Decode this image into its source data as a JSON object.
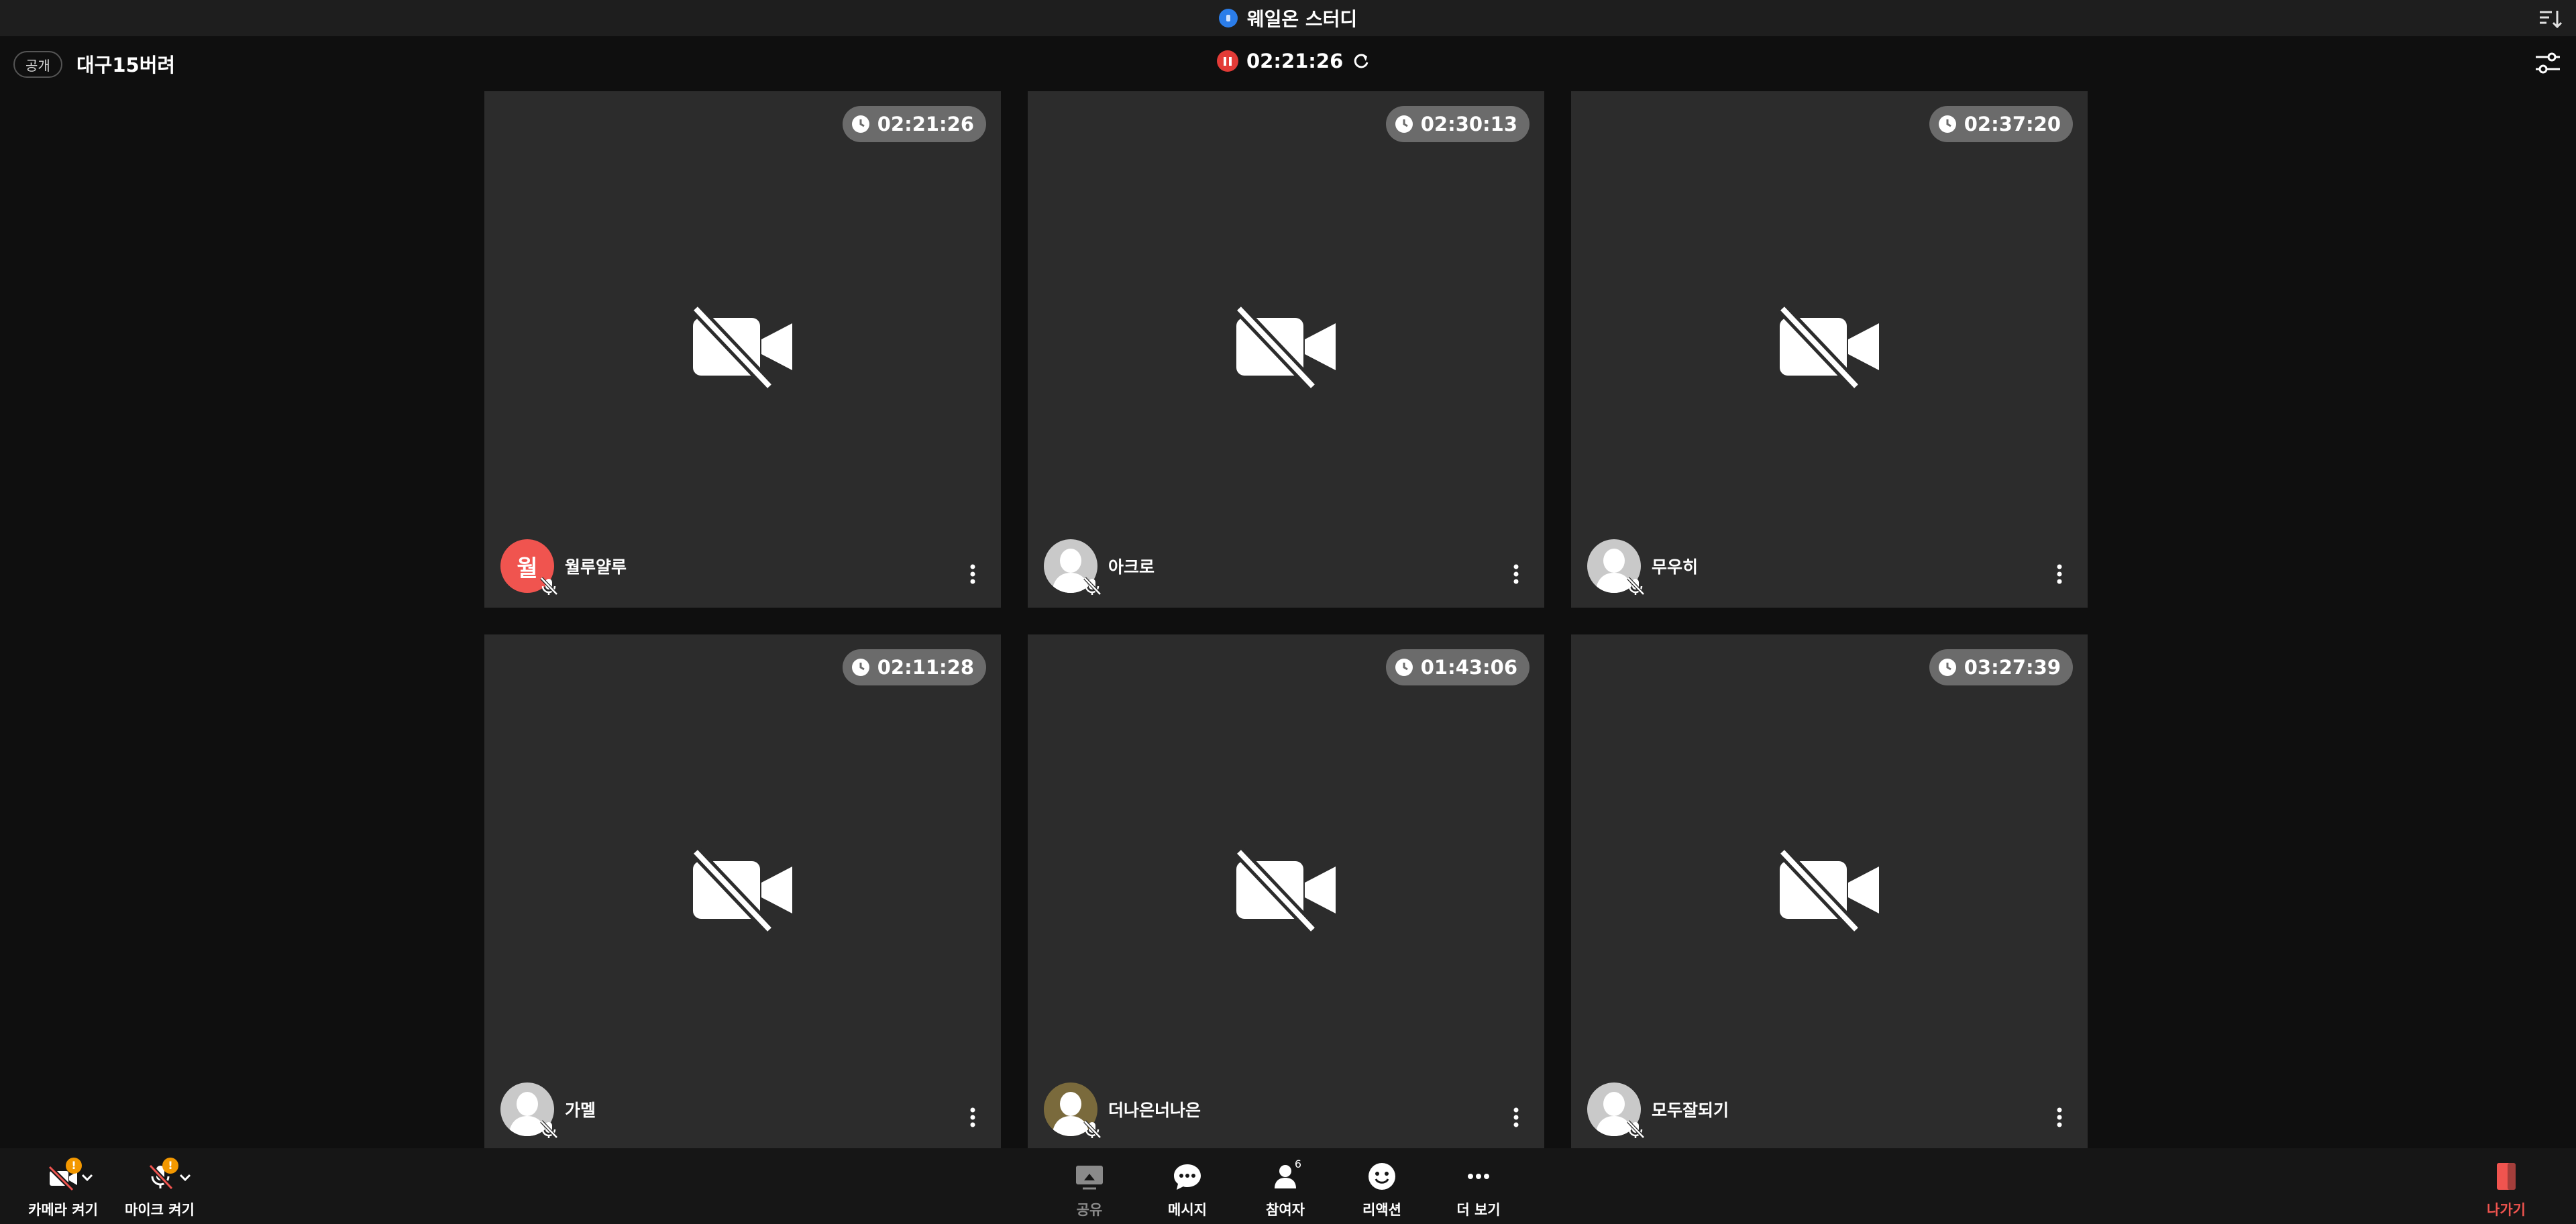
{
  "window": {
    "title": "웨일온 스터디"
  },
  "room": {
    "visibility": "공개",
    "name": "대구15버려"
  },
  "timer": {
    "elapsed": "02:21:26"
  },
  "tiles": [
    {
      "name": "월루얄루",
      "time": "02:21:26",
      "avatar_letter": "월"
    },
    {
      "name": "아크로",
      "time": "02:30:13",
      "avatar_letter": ""
    },
    {
      "name": "무우히",
      "time": "02:37:20",
      "avatar_letter": ""
    },
    {
      "name": "가멜",
      "time": "02:11:28",
      "avatar_letter": ""
    },
    {
      "name": "더나은너나은",
      "time": "01:43:06",
      "avatar_letter": ""
    },
    {
      "name": "모두잘되기",
      "time": "03:27:39",
      "avatar_letter": ""
    }
  ],
  "toolbar": {
    "camera": "카메라 켜기",
    "mic": "마이크 켜기",
    "share": "공유",
    "message": "메시지",
    "participants": "참여자",
    "participant_count": "6",
    "reaction": "리액션",
    "more": "더 보기",
    "exit": "나가기",
    "warning_mark": "!"
  },
  "colors": {
    "accent": "#2b7de9",
    "danger": "#e33b37",
    "exit": "#f0544f",
    "warning": "#f39800",
    "tile": "#2c2c2c"
  },
  "icons": {
    "camera_off": "camera-off-icon",
    "mic_off": "mic-off-icon",
    "clock": "clock-icon",
    "settings": "sliders-icon",
    "more": "kebab-icon"
  }
}
